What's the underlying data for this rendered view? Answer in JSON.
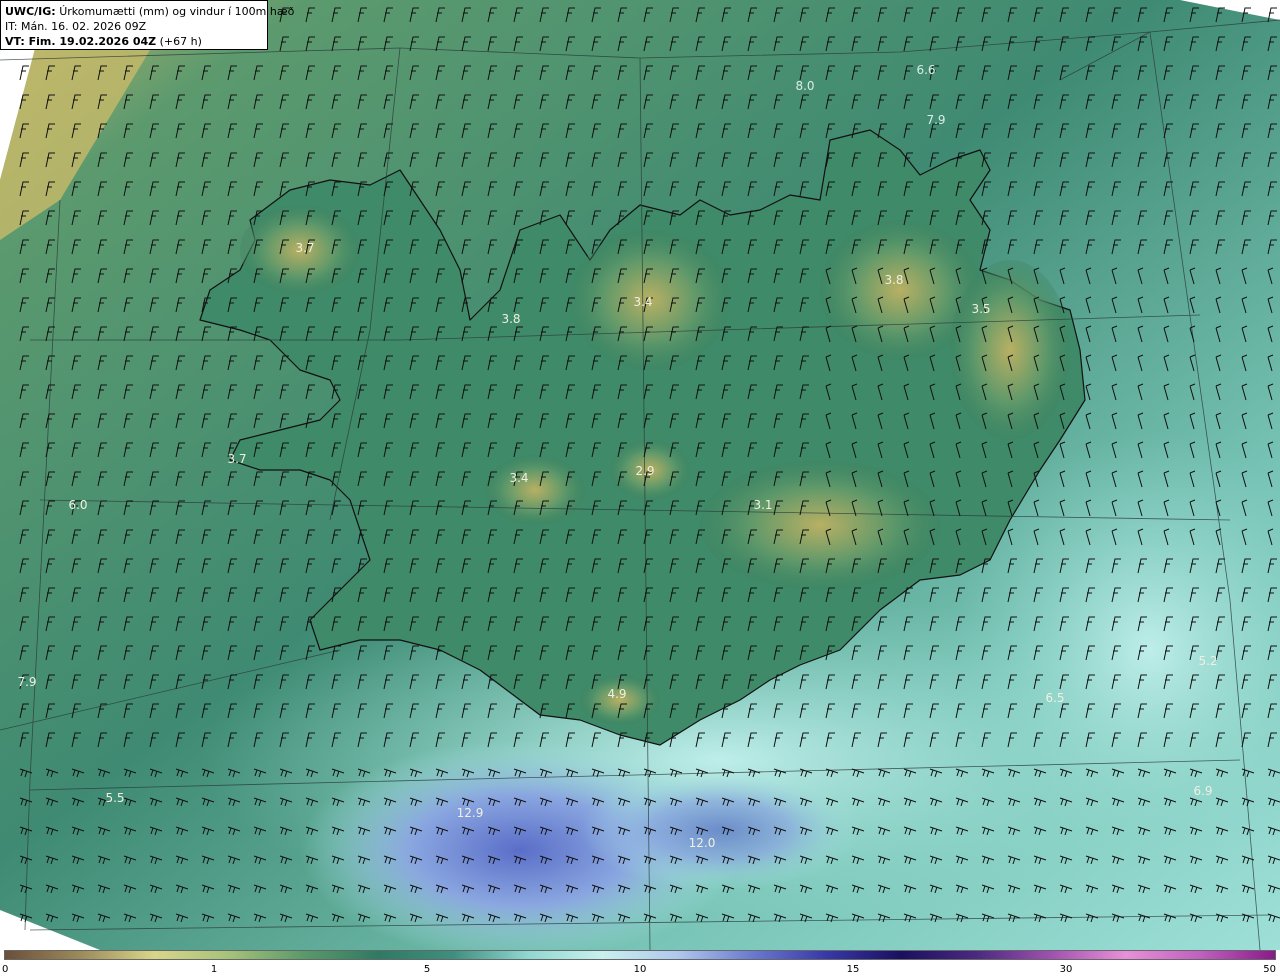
{
  "title": {
    "line1_bold": "UWC/IG:",
    "line1_text": "Úrkomumætti (mm) og vindur í 100m hæð",
    "line2": "IT: Mán. 16. 02. 2026 09Z",
    "line3_bold": "VT: Fim. 19.02.2026 04Z",
    "line3_text": "(+67 h)"
  },
  "map_values": [
    "8.0",
    "6.6",
    "7.9",
    "3.7",
    "3.4",
    "3.8",
    "3.5",
    "3.8",
    "3.7",
    "3.4",
    "2.9",
    "3.1",
    "6.0",
    "7.9",
    "4.9",
    "5.2",
    "5.5",
    "6.5",
    "12.9",
    "12.0",
    "6.9"
  ],
  "colorbar": {
    "ticks": [
      "0",
      "1",
      "5",
      "10",
      "15",
      "30",
      "50"
    ],
    "colors": [
      "#6b4f3a",
      "#9c8a5a",
      "#d8d68a",
      "#a6c27a",
      "#5a9a6a",
      "#2e7a64",
      "#3f8f80",
      "#8fd8d0",
      "#c8f0ee",
      "#b0c8ee",
      "#6a7ad0",
      "#3838a8",
      "#1a1060",
      "#4a2a80",
      "#a050b0",
      "#e890d8",
      "#c060c0",
      "#8a1a8a"
    ]
  }
}
